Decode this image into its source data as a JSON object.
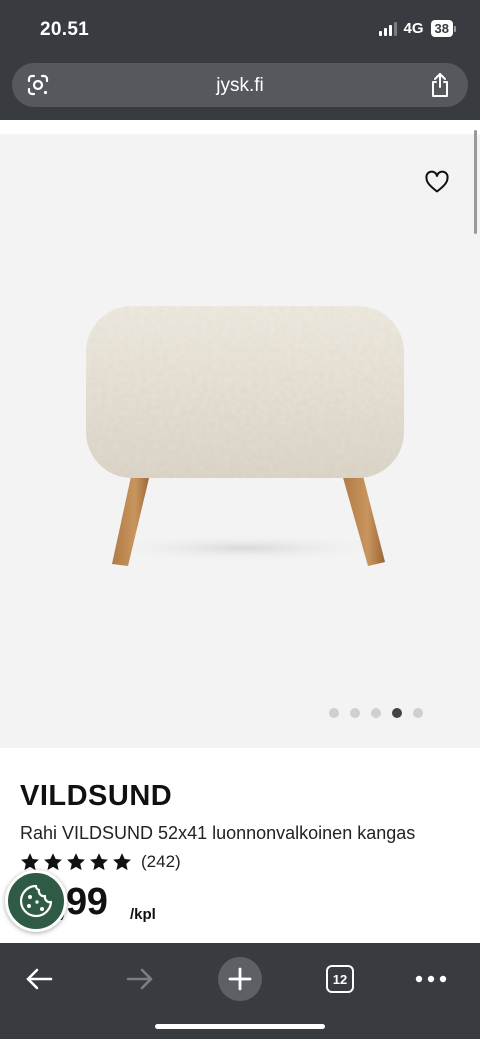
{
  "status_bar": {
    "time": "20.51",
    "network": "4G",
    "battery": "38"
  },
  "browser": {
    "url": "jysk.fi",
    "tab_count": "12"
  },
  "product": {
    "brand": "VILDSUND",
    "description": "Rahi VILDSUND 52x41 luonnonvalkoinen kangas",
    "rating_count": "(242)",
    "rating_stars": 5,
    "price": ",99",
    "unit": "/kpl",
    "gallery_total": 5,
    "gallery_active_index": 4
  },
  "colors": {
    "chrome": "#383b3f",
    "cookie_button": "#2f5a45"
  },
  "icons": {
    "lens": "lens-icon",
    "share": "share-icon",
    "favorite": "heart-icon",
    "back": "back-arrow-icon",
    "forward": "forward-arrow-icon",
    "new_tab": "plus-icon",
    "tabs": "tabs-icon",
    "menu": "more-icon",
    "cookie": "cookie-icon"
  }
}
